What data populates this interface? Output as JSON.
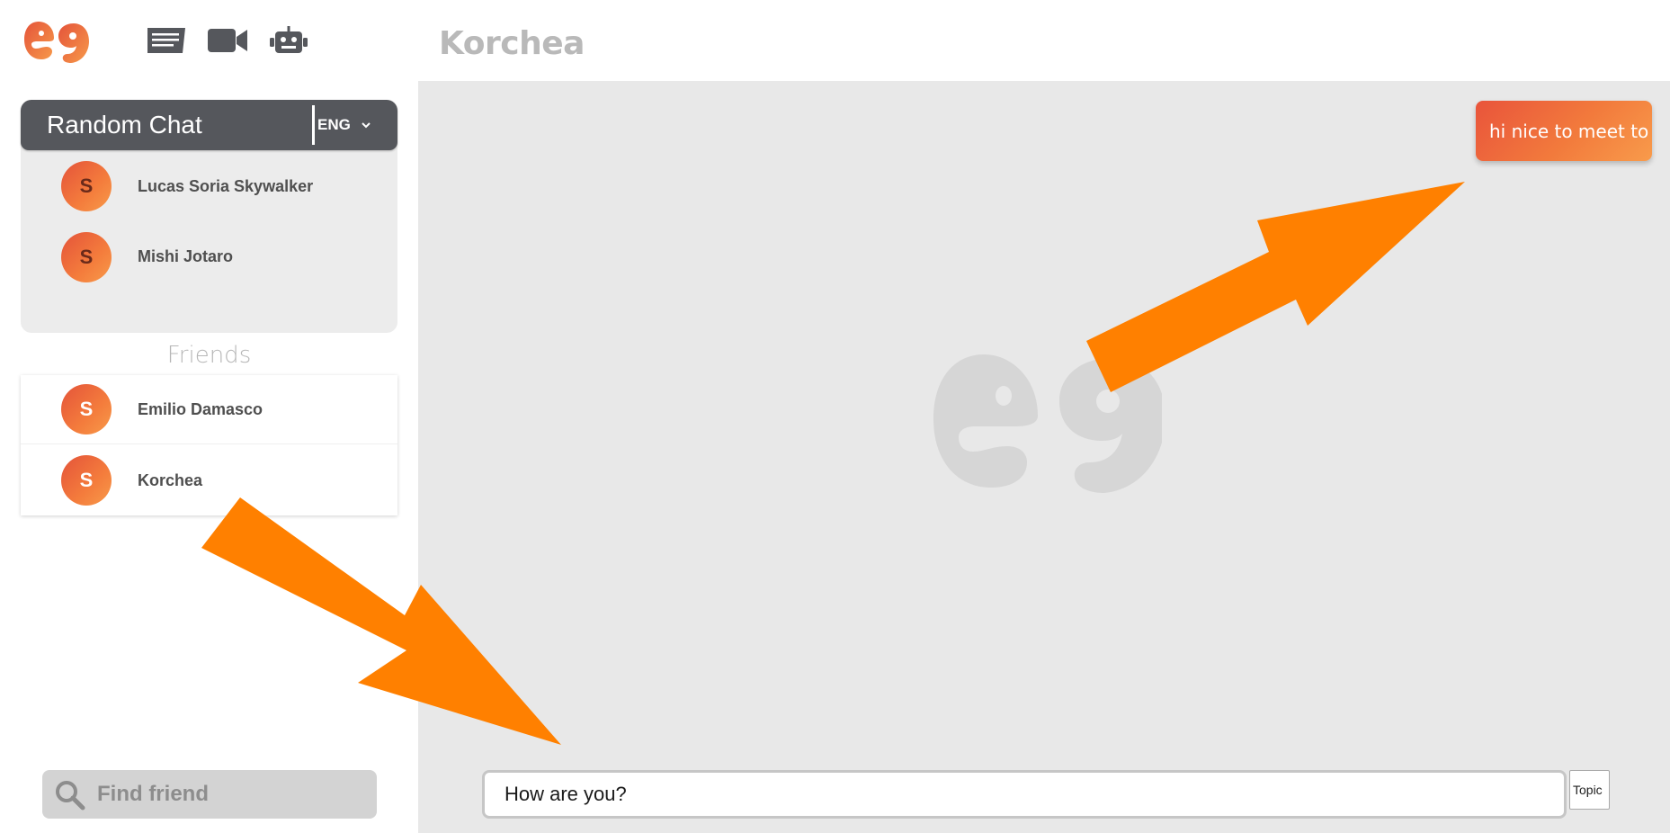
{
  "app": {
    "logo_icon": "eg-logo-icon",
    "brand_gradient": [
      "#e4533a",
      "#f79a4a"
    ]
  },
  "nav": {
    "icons": [
      "chat-list-icon",
      "video-camera-icon",
      "robot-icon"
    ]
  },
  "header": {
    "title": "Korchea"
  },
  "random_chat": {
    "title": "Random Chat",
    "language": "ENG",
    "users": [
      {
        "initial": "S",
        "name": "Lucas Soria Skywalker"
      },
      {
        "initial": "S",
        "name": "Mishi Jotaro"
      }
    ]
  },
  "friends": {
    "label": "Friends",
    "items": [
      {
        "initial": "S",
        "name": "Emilio Damasco"
      },
      {
        "initial": "S",
        "name": "Korchea"
      }
    ]
  },
  "search": {
    "placeholder": "Find friend"
  },
  "chat": {
    "messages": [
      {
        "from": "me",
        "text": "hi nice to meet to"
      }
    ],
    "watermark_icon": "eg-logo-icon"
  },
  "composer": {
    "value": "How are you?",
    "topic_label": "Topic"
  },
  "colors": {
    "header_dark": "#55575c",
    "chat_bg": "#e8e8e8",
    "annotation_arrow": "#ff8000"
  }
}
